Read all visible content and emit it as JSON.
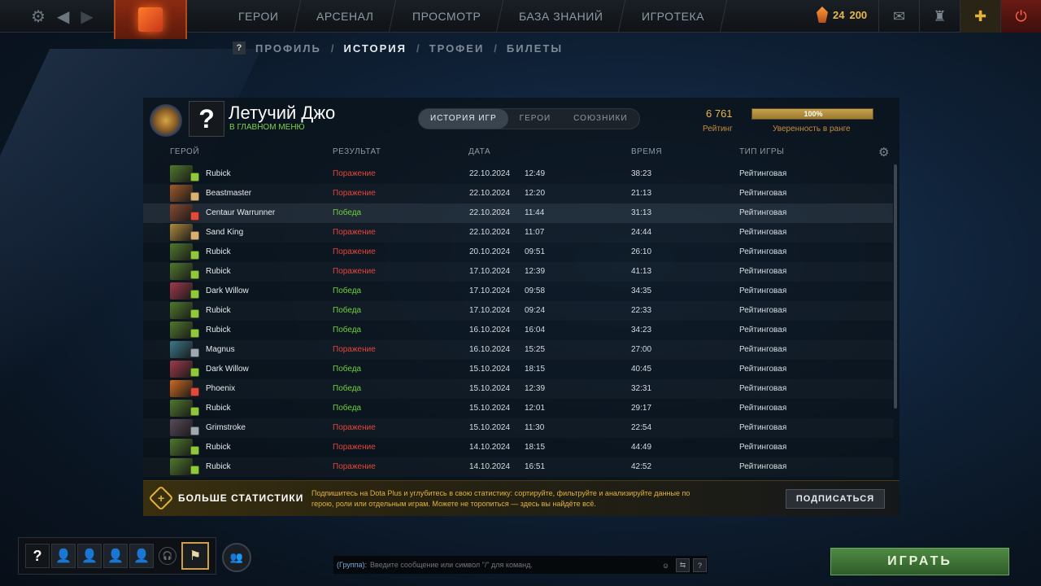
{
  "topbar": {
    "nav": [
      "ГЕРОИ",
      "АРСЕНАЛ",
      "ПРОСМОТР",
      "БАЗА ЗНАНИЙ",
      "ИГРОТЕКА"
    ],
    "currency_a": "24",
    "currency_b": "200"
  },
  "breadcrumbs": {
    "help": "?",
    "items": [
      "ПРОФИЛЬ",
      "ИСТОРИЯ",
      "ТРОФЕИ",
      "БИЛЕТЫ"
    ],
    "sep": "/"
  },
  "profile": {
    "avatar": "?",
    "name": "Летучий Джо",
    "status": "В ГЛАВНОМ МЕНЮ",
    "tabs": [
      "ИСТОРИЯ ИГР",
      "ГЕРОИ",
      "СОЮЗНИКИ"
    ],
    "rating": "6 761",
    "rating_label": "Рейтинг",
    "confidence": "100%",
    "confidence_value": 1.0,
    "confidence_label": "Уверенность в ранге"
  },
  "table": {
    "headers": {
      "hero": "ГЕРОЙ",
      "result": "РЕЗУЛЬТАТ",
      "date": "ДАТА",
      "duration": "ВРЕМЯ",
      "type": "ТИП ИГРЫ"
    },
    "colors": {
      "win": "#6fcf3a",
      "loss": "#e0463a"
    },
    "rows": [
      {
        "hero": "Rubick",
        "result": "Поражение",
        "win": false,
        "date": "22.10.2024",
        "time": "12:49",
        "duration": "38:23",
        "type": "Рейтинговая",
        "portrait": "#4f7a2a",
        "badge": "#8fc83a"
      },
      {
        "hero": "Beastmaster",
        "result": "Поражение",
        "win": false,
        "date": "22.10.2024",
        "time": "12:20",
        "duration": "21:13",
        "type": "Рейтинговая",
        "portrait": "#a05a2a",
        "badge": "#d8b070"
      },
      {
        "hero": "Centaur Warrunner",
        "result": "Победа",
        "win": true,
        "date": "22.10.2024",
        "time": "11:44",
        "duration": "31:13",
        "type": "Рейтинговая",
        "portrait": "#8a4a30",
        "badge": "#e04a3a"
      },
      {
        "hero": "Sand King",
        "result": "Поражение",
        "win": false,
        "date": "22.10.2024",
        "time": "11:07",
        "duration": "24:44",
        "type": "Рейтинговая",
        "portrait": "#b08a3a",
        "badge": "#d8b070"
      },
      {
        "hero": "Rubick",
        "result": "Поражение",
        "win": false,
        "date": "20.10.2024",
        "time": "09:51",
        "duration": "26:10",
        "type": "Рейтинговая",
        "portrait": "#4f7a2a",
        "badge": "#8fc83a"
      },
      {
        "hero": "Rubick",
        "result": "Поражение",
        "win": false,
        "date": "17.10.2024",
        "time": "12:39",
        "duration": "41:13",
        "type": "Рейтинговая",
        "portrait": "#4f7a2a",
        "badge": "#8fc83a"
      },
      {
        "hero": "Dark Willow",
        "result": "Победа",
        "win": true,
        "date": "17.10.2024",
        "time": "09:58",
        "duration": "34:35",
        "type": "Рейтинговая",
        "portrait": "#a03a4a",
        "badge": "#8fc83a"
      },
      {
        "hero": "Rubick",
        "result": "Победа",
        "win": true,
        "date": "17.10.2024",
        "time": "09:24",
        "duration": "22:33",
        "type": "Рейтинговая",
        "portrait": "#4f7a2a",
        "badge": "#8fc83a"
      },
      {
        "hero": "Rubick",
        "result": "Победа",
        "win": true,
        "date": "16.10.2024",
        "time": "16:04",
        "duration": "34:23",
        "type": "Рейтинговая",
        "portrait": "#4f7a2a",
        "badge": "#8fc83a"
      },
      {
        "hero": "Magnus",
        "result": "Поражение",
        "win": false,
        "date": "16.10.2024",
        "time": "15:25",
        "duration": "27:00",
        "type": "Рейтинговая",
        "portrait": "#3a7a8a",
        "badge": "#a0a8b0"
      },
      {
        "hero": "Dark Willow",
        "result": "Победа",
        "win": true,
        "date": "15.10.2024",
        "time": "18:15",
        "duration": "40:45",
        "type": "Рейтинговая",
        "portrait": "#a03a4a",
        "badge": "#8fc83a"
      },
      {
        "hero": "Phoenix",
        "result": "Победа",
        "win": true,
        "date": "15.10.2024",
        "time": "12:39",
        "duration": "32:31",
        "type": "Рейтинговая",
        "portrait": "#d06a20",
        "badge": "#e04a3a"
      },
      {
        "hero": "Rubick",
        "result": "Победа",
        "win": true,
        "date": "15.10.2024",
        "time": "12:01",
        "duration": "29:17",
        "type": "Рейтинговая",
        "portrait": "#4f7a2a",
        "badge": "#8fc83a"
      },
      {
        "hero": "Grimstroke",
        "result": "Поражение",
        "win": false,
        "date": "15.10.2024",
        "time": "11:30",
        "duration": "22:54",
        "type": "Рейтинговая",
        "portrait": "#5a4a5a",
        "badge": "#a0a8b0"
      },
      {
        "hero": "Rubick",
        "result": "Поражение",
        "win": false,
        "date": "14.10.2024",
        "time": "18:15",
        "duration": "44:49",
        "type": "Рейтинговая",
        "portrait": "#4f7a2a",
        "badge": "#8fc83a"
      },
      {
        "hero": "Rubick",
        "result": "Поражение",
        "win": false,
        "date": "14.10.2024",
        "time": "16:51",
        "duration": "42:52",
        "type": "Рейтинговая",
        "portrait": "#4f7a2a",
        "badge": "#8fc83a"
      }
    ]
  },
  "promo": {
    "icon": "+",
    "title": "БОЛЬШЕ СТАТИСТИКИ",
    "text": "Подпишитесь на Dota Plus и углубитесь в свою статистику: сортируйте, фильтруйте и анализируйте данные по герою, роли или отдельным играм. Можете не торопиться — здесь вы найдёте всё.",
    "button": "ПОДПИСАТЬСЯ"
  },
  "party": {
    "me": "?"
  },
  "chat": {
    "label": "(Группа):",
    "placeholder": "Введите сообщение или символ \"/\" для команд.",
    "help": "?"
  },
  "play": "ИГРАТЬ"
}
